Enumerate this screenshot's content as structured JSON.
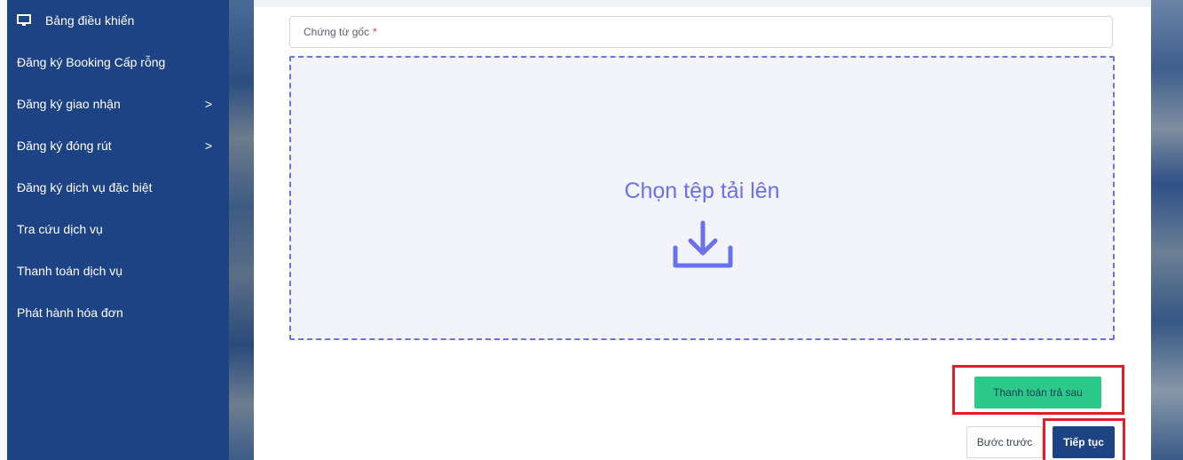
{
  "sidebar": {
    "items": [
      {
        "label": "Bảng điều khiển",
        "icon": "monitor-icon",
        "has_children": false
      },
      {
        "label": "Đăng ký Booking Cấp rỗng",
        "has_children": false
      },
      {
        "label": "Đăng ký giao nhận",
        "has_children": true
      },
      {
        "label": "Đăng ký đóng rút",
        "has_children": true
      },
      {
        "label": "Đăng ký dịch vụ đặc biệt",
        "has_children": false
      },
      {
        "label": "Tra cứu dịch vụ",
        "has_children": false
      },
      {
        "label": "Thanh toán dịch vụ",
        "has_children": false
      },
      {
        "label": "Phát hành hóa đơn",
        "has_children": false
      }
    ],
    "chevron": ">"
  },
  "form": {
    "field_label": "Chứng từ gốc",
    "required_mark": "*",
    "upload_text": "Chọn tệp tải lên",
    "upload_icon": "download-icon"
  },
  "actions": {
    "pay_later_label": "Thanh toán trả sau",
    "back_label": "Bước trước",
    "next_label": "Tiếp tục"
  },
  "colors": {
    "sidebar_bg": "#1e4385",
    "accent": "#6a71ea",
    "green": "#2bc88a",
    "highlight": "#e11d2a"
  }
}
